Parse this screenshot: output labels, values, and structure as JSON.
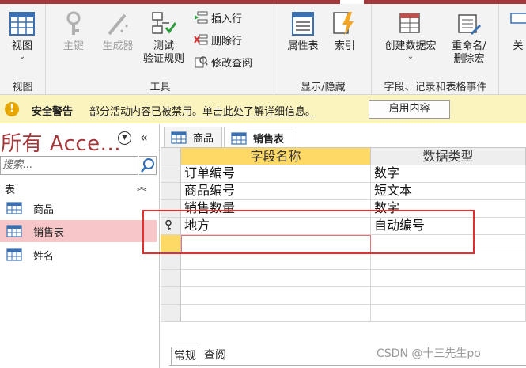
{
  "ribbon": {
    "groups": {
      "views": {
        "label": "视图",
        "buttons": {
          "view": "视图"
        }
      },
      "tools": {
        "label": "工具",
        "buttons": {
          "primary_key": "主键",
          "builder": "生成器",
          "test_rules_line1": "测试",
          "test_rules_line2": "验证规则",
          "insert_rows": "插入行",
          "delete_rows": "删除行",
          "modify_lookups": "修改查阅"
        }
      },
      "show_hide": {
        "label": "显示/隐藏",
        "buttons": {
          "property_sheet": "属性表",
          "indexes": "索引"
        }
      },
      "field_events": {
        "label": "字段、记录和表格事件",
        "buttons": {
          "create_macros": "创建数据宏",
          "rename_macro_line1": "重命名/",
          "rename_macro_line2": "删除宏"
        }
      },
      "cut_off": {
        "buttons": {
          "partial": "关"
        }
      }
    }
  },
  "security_bar": {
    "title": "安全警告",
    "message": "部分活动内容已被禁用。单击此处了解详细信息。",
    "enable_button": "启用内容"
  },
  "nav_pane": {
    "title": "所有 Acce...",
    "search_placeholder": "搜索...",
    "group_header": "表",
    "items": [
      {
        "label": "商品",
        "selected": false
      },
      {
        "label": "销售表",
        "selected": true
      },
      {
        "label": "姓名",
        "selected": false
      }
    ]
  },
  "document": {
    "tabs": [
      {
        "label": "商品",
        "active": false
      },
      {
        "label": "销售表",
        "active": true
      }
    ],
    "columns": {
      "field_name": "字段名称",
      "data_type": "数据类型"
    },
    "rows": [
      {
        "field_name": "订单编号",
        "data_type": "数字"
      },
      {
        "field_name": "商品编号",
        "data_type": "短文本"
      },
      {
        "field_name": "销售数量",
        "data_type": "数字"
      },
      {
        "field_name": "地方",
        "data_type": "自动编号",
        "primary_key": true
      },
      {
        "field_name": "",
        "data_type": ""
      }
    ],
    "bottom_tabs": [
      "常规",
      "查阅"
    ]
  },
  "watermark": "CSDN @十三先生po",
  "colors": {
    "brand": "#a4373a",
    "security_bar": "#fbf4bf",
    "selected_nav": "#f7c6c8",
    "active_cell": "#ffd966",
    "highlight_box": "#e03030"
  }
}
